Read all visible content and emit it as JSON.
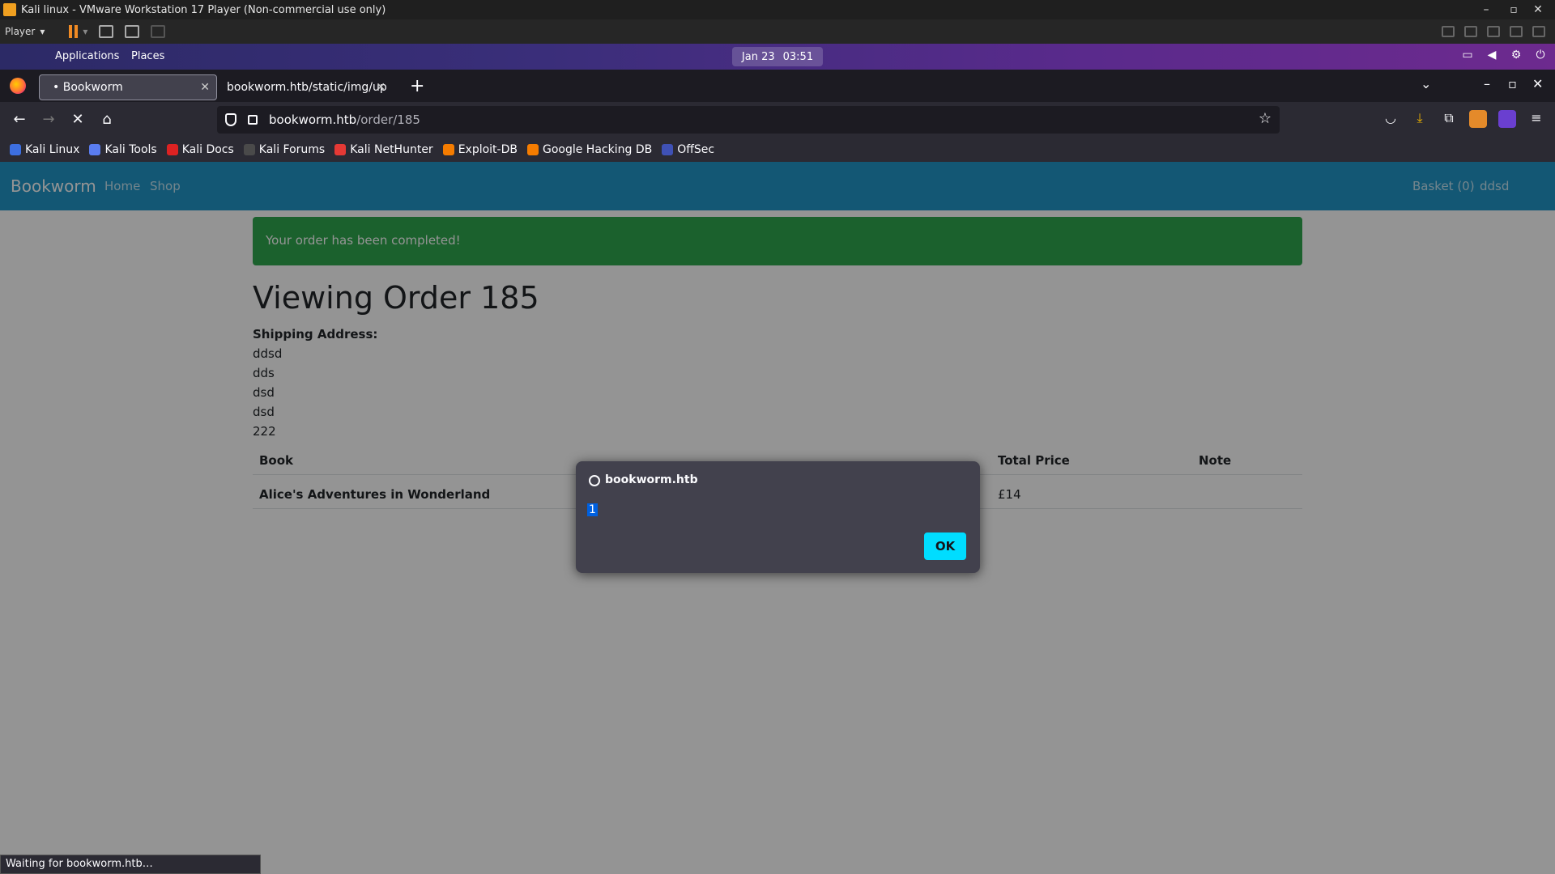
{
  "vm": {
    "title": "Kali linux - VMware Workstation 17 Player (Non-commercial use only)",
    "player_label": "Player"
  },
  "panel": {
    "applications": "Applications",
    "places": "Places",
    "date": "Jan 23",
    "time": "03:51"
  },
  "browser": {
    "tabs": [
      {
        "label": "• Bookworm"
      },
      {
        "label": "bookworm.htb/static/img/up"
      }
    ],
    "url_host": "bookworm.htb",
    "url_path": "/order/185",
    "bookmarks": [
      {
        "label": "Kali Linux",
        "color": "#3d6fe0"
      },
      {
        "label": "Kali Tools",
        "color": "#5a7df0"
      },
      {
        "label": "Kali Docs",
        "color": "#d22"
      },
      {
        "label": "Kali Forums",
        "color": "#4a4a4a"
      },
      {
        "label": "Kali NetHunter",
        "color": "#e53935"
      },
      {
        "label": "Exploit-DB",
        "color": "#f57c00"
      },
      {
        "label": "Google Hacking DB",
        "color": "#f57c00"
      },
      {
        "label": "OffSec",
        "color": "#3f51b5"
      }
    ],
    "status": "Waiting for bookworm.htb…"
  },
  "site": {
    "brand": "Bookworm",
    "nav": {
      "home": "Home",
      "shop": "Shop",
      "basket": "Basket (0)",
      "user": "ddsd"
    },
    "alert": "Your order has been completed!",
    "order_title": "Viewing Order 185",
    "shipping_label": "Shipping Address:",
    "address": [
      "ddsd",
      "dds",
      "dsd",
      "dsd",
      "222"
    ],
    "table": {
      "headers": {
        "book": "Book",
        "total": "Total Price",
        "note": "Note"
      },
      "rows": [
        {
          "book": "Alice's Adventures in Wonderland",
          "total": "£14",
          "note": ""
        }
      ]
    }
  },
  "dialog": {
    "host": "bookworm.htb",
    "message": "1",
    "ok": "OK"
  }
}
